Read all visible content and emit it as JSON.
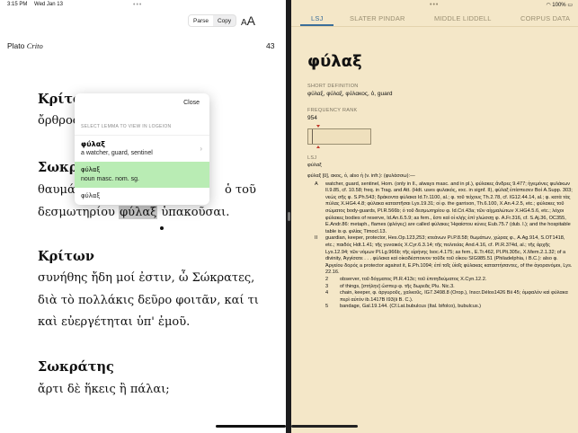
{
  "status": {
    "time": "3:15 PM",
    "date": "Wed Jan 13",
    "battery": "100%"
  },
  "reader": {
    "parse_label": "Parse",
    "copy_label": "Copy",
    "font_small": "A",
    "font_big": "A",
    "author": "Plato",
    "work": "Crito",
    "page": "43",
    "lines": [
      {
        "type": "speaker",
        "text": "Κρίτων"
      },
      {
        "type": "line",
        "text": "ὄρθρος"
      },
      {
        "type": "speaker",
        "text": "Σωκράτης"
      },
      {
        "type": "line",
        "text": "θαυμάζω"
      },
      {
        "type": "line_a",
        "text": "δεσμωτηρίου"
      },
      {
        "type": "line_b",
        "text": "φύλαξ"
      },
      {
        "type": "line_c",
        "text": "ὑπακοῦσαι."
      },
      {
        "type": "speaker",
        "text": "Κρίτων"
      },
      {
        "type": "line",
        "text": "συνήθης ἤδη μοί ἐστιν, ὦ Σώκρατες,"
      },
      {
        "type": "line",
        "text": "διὰ τὸ πολλάκις δεῦρο φοιτᾶν, καί τι"
      },
      {
        "type": "line",
        "text": "καὶ εὐεργέτηται ὑπ' ἐμοῦ."
      },
      {
        "type": "speaker",
        "text": "Σωκράτης"
      },
      {
        "type": "line",
        "text": "ἄρτι δὲ ἥκεις ἢ πάλαι;"
      }
    ],
    "line_tail": "ὁ τοῦ"
  },
  "popup": {
    "close_label": "Close",
    "header": "SELECT LEMMA TO VIEW IN LOGEION",
    "options": [
      {
        "word": "φύλαξ",
        "gloss": "a watcher, guard, sentinel"
      },
      {
        "word": "φύλαξ",
        "gloss": "noun masc. nom. sg."
      },
      {
        "word": "φύλαξ",
        "gloss": ""
      }
    ]
  },
  "dictionary": {
    "tabs": [
      "LSJ",
      "SLATER PINDAR",
      "MIDDLE LIDDELL",
      "CORPUS DATA"
    ],
    "active_tab": "LSJ",
    "lemma": "φύλαξ",
    "short_def_label": "SHORT DEFINITION",
    "short_def": "φύλαξ, φύλαξ, φύλακος, ὁ, guard",
    "freq_label": "FREQUENCY RANK",
    "freq_rank": "954",
    "source_label": "LSJ",
    "source_word": "φύλαξ",
    "intro": "φύλαξ [ῠ], ακος, ὁ, also ἡ (v. infr.): (φυλάσσω):—",
    "senses": [
      {
        "num": "A",
        "level": 0,
        "text": "watcher, guard, sentinel, Hom. (only in Il., always masc. and in pl.), φύλακες ἄνδρες 9.477; ἡγεμόνες φυλάκων Il.9.85, cf. 10.58; freq. in Trag. and Att. (Hdt. uses φυλακός, exc. in signf. II), φύλαξ ἐπίσπεσεν Βοί A.Supp. 303; νεώς σῆς φ. S.Ph.543; δράκοντα φύλακα Id.Tr.1100, al.; φ. τοῦ τείχους Th.2.78, cf. IG12.44.14, al.; φ. κατὰ τὰς πύλας X.HG4.4.8; φύλακα καταστῆσαι Lys.19.31; οἱ φ. the garrison, Th.6.100, X.An.4.2.5, etc.; φύλακες τοῦ σώματος body-guards, Pl.R.566b; ὁ τοῦ δεσμωτηρίου φ. Id.Cri.43a; τῶν αἰχμαλώτων X.HG4.5.6, etc.; λόχοι φύλακες bodies of reserve, Id.An.6.5.9; as fem., ἔστι καὶ οἱ κλῄς ἐπὶ γλώσσῃ φ. A.Fr.316, cf. S.Aj.36, OC355, E.Andr.86: metaph., flames (φλόγες) are called φύλακες Ἡφαίστου κύνες Eub.75.7 (dub. l.); and the hospitable table is φ. φιλίας Timocl.13."
      },
      {
        "num": "II",
        "level": 0,
        "text": "guardian, keeper, protector, Hes.Op.123,253; κτεάνων Pi.P.8.58; θωμάτων, χώρας φ., A.Ag.914, S.OT1418, etc.; παιδός Hdt.1.41; τῆς γυναικός X.Cyr.6.3.14; τῆς πολιτείας And.4.16, cf. Pl.R.374d, al.; τῆς ἀρχῆς Lys.12.94; τῶν νόμων Pl.Lg.966b; τῆς εἰρήνης Isoc.4.175; as fem., E.Tr.462, Pl.Plt.305c, X.Mem.2.1.32; of a divinity, Ἀγγίσατε . . . φύλακα καὶ οἰκοδέσποινον τοῦδε τοῦ οἴκου SIG985.51 (Philadelphia, i B.C.): also φ. Ἀργείου δορός a protector against it, E.Ph.1094; ἐπὶ τοῖς ὑἱοῖς φύλακας καταστήσαντες, of the ἀγορανόμοι, Lys. 22.16."
      },
      {
        "num": "2",
        "level": 1,
        "text": "observer, τοῦ δόγματος Pl.R.413c; τοῦ ἐπιτηδεύματος X.Cyn.12.2."
      },
      {
        "num": "3",
        "level": 1,
        "text": "of things, [στήλην] ὥσπερ φ. τῆς δωρεᾶς Plu. Nic.3."
      },
      {
        "num": "4",
        "level": 1,
        "text": "chain, keeper, φ. ἀργυροῦς, χαλκοῦς, IG7.3498.8 (Orop.), Inscr.Délos1426 Bii 45; ὀμφαλὸν καὶ φύλακα περὶ αὐτὸν ib.1417B I93(ii B. C.)."
      },
      {
        "num": "5",
        "level": 1,
        "text": "bandage, Gal.19.144. (Cf.Lat.bubulcus (Ital. bifolco), bubulcus.)"
      }
    ]
  }
}
